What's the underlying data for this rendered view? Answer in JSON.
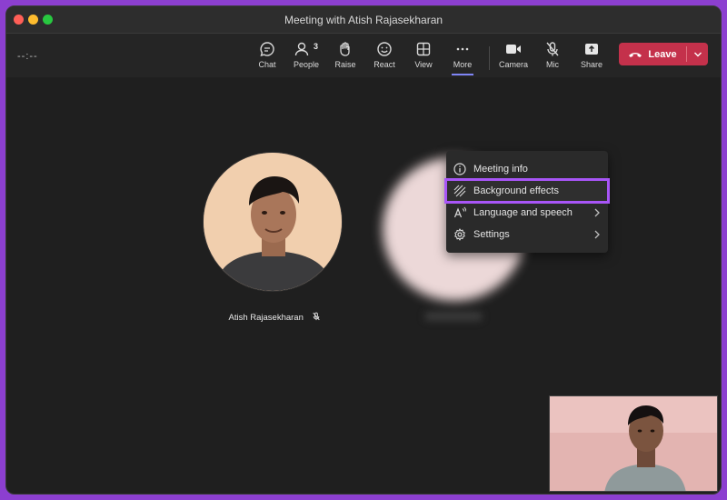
{
  "window": {
    "title": "Meeting with Atish Rajasekharan"
  },
  "toolbar": {
    "timer": "--:--",
    "chat": "Chat",
    "people": "People",
    "people_count": "3",
    "raise": "Raise",
    "react": "React",
    "view": "View",
    "more": "More",
    "camera": "Camera",
    "mic": "Mic",
    "share": "Share",
    "leave": "Leave"
  },
  "menu": {
    "items": [
      {
        "label": "Meeting info",
        "icon": "info-icon"
      },
      {
        "label": "Background effects",
        "icon": "background-effects-icon"
      },
      {
        "label": "Language and speech",
        "icon": "language-icon"
      },
      {
        "label": "Settings",
        "icon": "gear-icon"
      }
    ]
  },
  "participants": [
    {
      "name": "Atish Rajasekharan",
      "muted": true
    }
  ],
  "colors": {
    "accent": "#a855f7",
    "leave": "#c4314b",
    "more_underline": "#7f85f5"
  }
}
